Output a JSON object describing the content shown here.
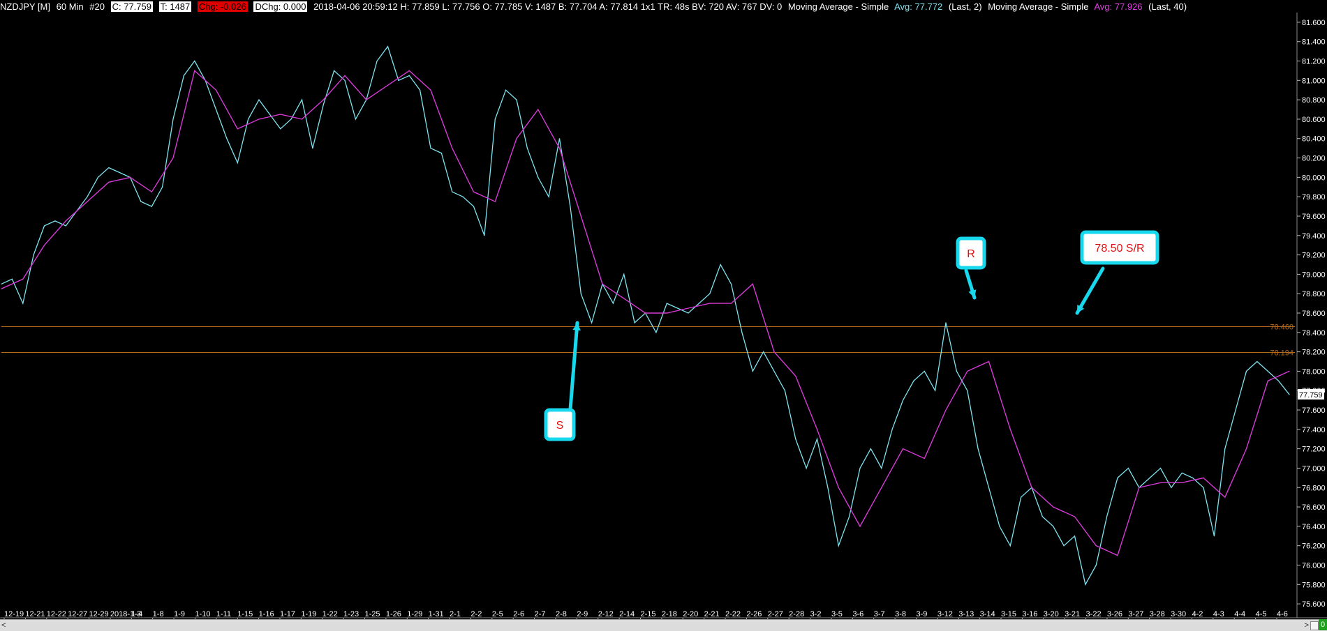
{
  "header": {
    "symbol": "NZDJPY [M]",
    "interval": "60 Min",
    "bar_no": "#20",
    "close": "C: 77.759",
    "ticks": "T: 1487",
    "chg": "Chg: -0.026",
    "dchg": "DChg: 0.000",
    "rest": "2018-04-06 20:59:12 H: 77.859 L: 77.756 O: 77.785 V: 1487 B: 77.704 A: 77.814 1x1 TR: 48s BV: 720 AV: 767 DV: 0",
    "ma1_label": "Moving Average - Simple",
    "ma1_avg": "Avg: 77.772",
    "ma1_len": "(Last, 2)",
    "ma2_label": "Moving Average - Simple",
    "ma2_avg": "Avg: 77.926",
    "ma2_len": "(Last, 40)"
  },
  "colors": {
    "price": "#7fe3f0",
    "ma": "#d63ad6",
    "level": "#b86a1c",
    "callout": "#18d8ee",
    "callout_text": "#e01010",
    "axis_text": "#ffffff",
    "last_box": "#ffffff"
  },
  "chart_data": {
    "type": "line",
    "y_axis_ticks": [
      "81.600",
      "81.400",
      "81.200",
      "81.000",
      "80.800",
      "80.600",
      "80.400",
      "80.200",
      "80.000",
      "79.800",
      "79.600",
      "79.400",
      "79.200",
      "79.000",
      "78.800",
      "78.600",
      "78.400",
      "78.200",
      "78.000",
      "77.800",
      "77.600",
      "77.400",
      "77.200",
      "77.000",
      "76.800",
      "76.600",
      "76.400",
      "76.200",
      "76.000",
      "75.800",
      "75.600"
    ],
    "ylim": [
      75.5,
      81.7
    ],
    "x_labels": [
      "12-19",
      "12-21",
      "12-22",
      "12-27",
      "12-29",
      "2018-1-3",
      "1-4",
      "1-8",
      "1-9",
      "1-10",
      "1-11",
      "1-15",
      "1-16",
      "1-17",
      "1-19",
      "1-22",
      "1-23",
      "1-25",
      "1-26",
      "1-29",
      "1-31",
      "2-1",
      "2-2",
      "2-5",
      "2-6",
      "2-7",
      "2-8",
      "2-9",
      "2-12",
      "2-14",
      "2-15",
      "2-18",
      "2-20",
      "2-21",
      "2-22",
      "2-26",
      "2-27",
      "2-28",
      "3-2",
      "3-5",
      "3-6",
      "3-7",
      "3-8",
      "3-9",
      "3-12",
      "3-13",
      "3-14",
      "3-15",
      "3-16",
      "3-20",
      "3-21",
      "3-22",
      "3-26",
      "3-27",
      "3-28",
      "3-30",
      "4-2",
      "4-3",
      "4-4",
      "4-5",
      "4-6"
    ],
    "series": [
      {
        "name": "NZDJPY",
        "x": [
          0,
          1,
          2,
          3,
          4,
          5,
          6,
          7,
          8,
          9,
          10,
          11,
          12,
          13,
          14,
          15,
          16,
          17,
          18,
          19,
          20,
          21,
          22,
          23,
          24,
          25,
          26,
          27,
          28,
          29,
          30,
          31,
          32,
          33,
          34,
          35,
          36,
          37,
          38,
          39,
          40,
          41,
          42,
          43,
          44,
          45,
          46,
          47,
          48,
          49,
          50,
          51,
          52,
          53,
          54,
          55,
          56,
          57,
          58,
          59,
          60,
          61,
          62,
          63,
          64,
          65,
          66,
          67,
          68,
          69,
          70,
          71,
          72,
          73,
          74,
          75,
          76,
          77,
          78,
          79,
          80,
          81,
          82,
          83,
          84,
          85,
          86,
          87,
          88,
          89,
          90,
          91,
          92,
          93,
          94,
          95,
          96,
          97,
          98,
          99,
          100,
          101,
          102,
          103,
          104,
          105,
          106,
          107,
          108,
          109,
          110,
          111,
          112,
          113,
          114,
          115,
          116,
          117,
          118,
          119,
          120
        ],
        "values": [
          78.9,
          78.95,
          78.7,
          79.2,
          79.5,
          79.55,
          79.5,
          79.65,
          79.8,
          80.0,
          80.1,
          80.05,
          80.0,
          79.75,
          79.7,
          79.9,
          80.6,
          81.05,
          81.2,
          81.0,
          80.7,
          80.4,
          80.15,
          80.6,
          80.8,
          80.65,
          80.5,
          80.6,
          80.8,
          80.3,
          80.75,
          81.1,
          81.0,
          80.6,
          80.8,
          81.2,
          81.35,
          81.0,
          81.05,
          80.9,
          80.3,
          80.25,
          79.85,
          79.8,
          79.7,
          79.4,
          80.6,
          80.9,
          80.8,
          80.3,
          80.0,
          79.8,
          80.4,
          79.7,
          78.8,
          78.5,
          78.9,
          78.7,
          79.0,
          78.5,
          78.6,
          78.4,
          78.7,
          78.65,
          78.6,
          78.7,
          78.8,
          79.1,
          78.9,
          78.4,
          78.0,
          78.2,
          78.0,
          77.8,
          77.3,
          77.0,
          77.3,
          76.8,
          76.2,
          76.5,
          77.0,
          77.2,
          77.0,
          77.4,
          77.7,
          77.9,
          78.0,
          77.8,
          78.5,
          78.0,
          77.8,
          77.2,
          76.8,
          76.4,
          76.2,
          76.7,
          76.8,
          76.5,
          76.4,
          76.2,
          76.3,
          75.8,
          76.0,
          76.5,
          76.9,
          77.0,
          76.8,
          76.9,
          77.0,
          76.8,
          76.95,
          76.9,
          76.8,
          76.3,
          77.2,
          77.6,
          78.0,
          78.1,
          78.0,
          77.9,
          77.76
        ]
      },
      {
        "name": "Moving Average - Simple",
        "x": [
          0,
          2,
          4,
          6,
          8,
          10,
          12,
          14,
          16,
          18,
          20,
          22,
          24,
          26,
          28,
          30,
          32,
          34,
          36,
          38,
          40,
          42,
          44,
          46,
          48,
          50,
          52,
          54,
          56,
          58,
          60,
          62,
          64,
          66,
          68,
          70,
          72,
          74,
          76,
          78,
          80,
          82,
          84,
          86,
          88,
          90,
          92,
          94,
          96,
          98,
          100,
          102,
          104,
          106,
          108,
          110,
          112,
          114,
          116,
          118,
          120
        ],
        "values": [
          78.85,
          78.95,
          79.3,
          79.55,
          79.75,
          79.95,
          80.0,
          79.85,
          80.2,
          81.1,
          80.9,
          80.5,
          80.6,
          80.65,
          80.6,
          80.8,
          81.05,
          80.8,
          80.95,
          81.1,
          80.9,
          80.3,
          79.85,
          79.75,
          80.4,
          80.7,
          80.3,
          79.6,
          78.9,
          78.75,
          78.6,
          78.6,
          78.65,
          78.7,
          78.7,
          78.9,
          78.2,
          77.95,
          77.4,
          76.8,
          76.4,
          76.8,
          77.2,
          77.1,
          77.6,
          78.0,
          78.1,
          77.4,
          76.8,
          76.6,
          76.5,
          76.2,
          76.1,
          76.8,
          76.85,
          76.85,
          76.9,
          76.7,
          77.2,
          77.9,
          78.0
        ]
      }
    ],
    "levels": [
      {
        "value": 78.46,
        "label": "78.460"
      },
      {
        "value": 78.194,
        "label": "78.194"
      }
    ],
    "last_price": "77.759"
  },
  "annotations": {
    "s_label": "S",
    "r_label": "R",
    "sr_label": "78.50 S/R"
  },
  "bottom": {
    "left_arrow": "<",
    "right_arrow": ">",
    "counter": "0"
  }
}
